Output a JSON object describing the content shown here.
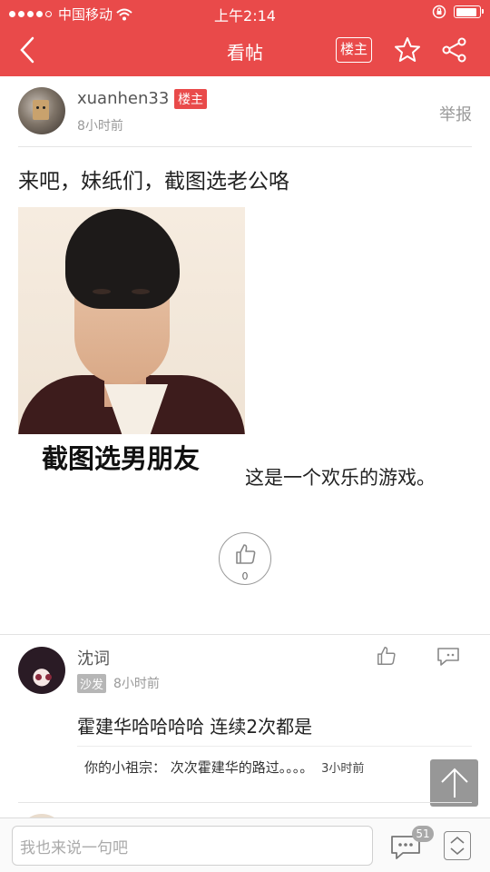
{
  "status_bar": {
    "carrier": "中国移动",
    "time": "上午2:14",
    "battery_level": 0.9,
    "signal_bars": 4,
    "signal_total": 5
  },
  "nav": {
    "title": "看帖",
    "owner_only_label": "楼主"
  },
  "post": {
    "author": "xuanhen33",
    "author_badge": "楼主",
    "time": "8小时前",
    "report_label": "举报",
    "title": "来吧，妹纸们，截图选老公咯",
    "image_caption": "截图选男朋友",
    "body": "这是一个欢乐的游戏。",
    "like_count": "0"
  },
  "comments": [
    {
      "name": "沈词",
      "badge": "沙发",
      "time": "8小时前",
      "text": "霍建华哈哈哈哈 连续2次都是",
      "reply": {
        "user": "你的小祖宗：",
        "text": "次次霍建华的路过。。。。",
        "time": "3小时前"
      }
    }
  ],
  "bottom_bar": {
    "input_placeholder": "我也来说一句吧",
    "comment_count": "51"
  }
}
